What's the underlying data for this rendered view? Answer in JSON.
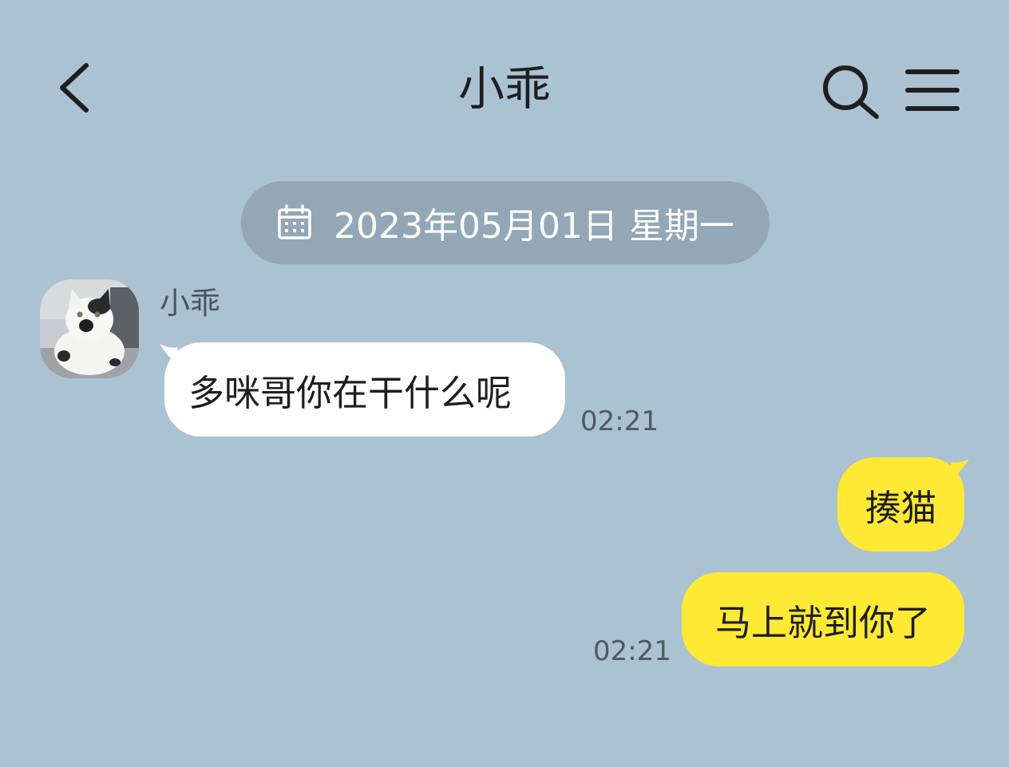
{
  "header": {
    "title": "小乖",
    "back_icon": "chevron-left-icon",
    "search_icon": "search-icon",
    "menu_icon": "hamburger-menu-icon"
  },
  "date_divider": {
    "icon": "calendar-icon",
    "text": "2023年05月01日 星期一"
  },
  "messages": [
    {
      "direction": "incoming",
      "sender": "小乖",
      "text": "多咪哥你在干什么呢",
      "time": "02:21"
    },
    {
      "direction": "outgoing",
      "text": "揍猫",
      "time": ""
    },
    {
      "direction": "outgoing",
      "text": "马上就到你了",
      "time": "02:21"
    }
  ],
  "colors": {
    "background": "#abc2d2",
    "date_pill": "#93a7b6",
    "incoming_bubble": "#ffffff",
    "outgoing_bubble": "#fee935"
  }
}
